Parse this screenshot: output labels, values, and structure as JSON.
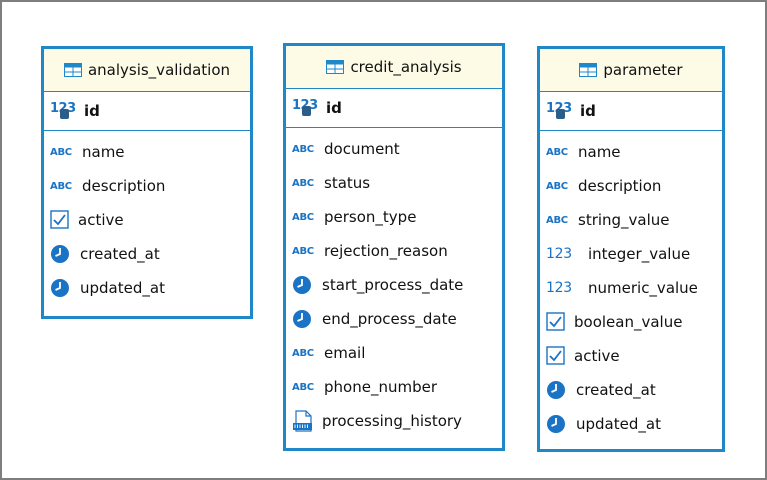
{
  "tables": [
    {
      "name": "analysis_validation",
      "pk": "id",
      "columns": [
        {
          "label": "name",
          "icon": "abc-icon"
        },
        {
          "label": "description",
          "icon": "abc-icon"
        },
        {
          "label": "active",
          "icon": "checkbox-icon"
        },
        {
          "label": "created_at",
          "icon": "clock-icon"
        },
        {
          "label": "updated_at",
          "icon": "clock-icon"
        }
      ]
    },
    {
      "name": "credit_analysis",
      "pk": "id",
      "columns": [
        {
          "label": "document",
          "icon": "abc-icon"
        },
        {
          "label": "status",
          "icon": "abc-icon"
        },
        {
          "label": "person_type",
          "icon": "abc-icon"
        },
        {
          "label": "rejection_reason",
          "icon": "abc-icon"
        },
        {
          "label": "start_process_date",
          "icon": "clock-icon"
        },
        {
          "label": "end_process_date",
          "icon": "clock-icon"
        },
        {
          "label": "email",
          "icon": "abc-icon"
        },
        {
          "label": "phone_number",
          "icon": "abc-icon"
        },
        {
          "label": "processing_history",
          "icon": "json-icon"
        }
      ]
    },
    {
      "name": "parameter",
      "pk": "id",
      "columns": [
        {
          "label": "name",
          "icon": "abc-icon"
        },
        {
          "label": "description",
          "icon": "abc-icon"
        },
        {
          "label": "string_value",
          "icon": "abc-icon"
        },
        {
          "label": "integer_value",
          "icon": "number-icon"
        },
        {
          "label": "numeric_value",
          "icon": "number-icon"
        },
        {
          "label": "boolean_value",
          "icon": "checkbox-icon"
        },
        {
          "label": "active",
          "icon": "checkbox-icon"
        },
        {
          "label": "created_at",
          "icon": "clock-icon"
        },
        {
          "label": "updated_at",
          "icon": "clock-icon"
        }
      ]
    }
  ],
  "icon_text": {
    "abc": "ABC",
    "num": "123"
  },
  "colors": {
    "entity_border": "#1f88c8",
    "header_bg": "#fdfbe6",
    "icon_blue": "#1a73c4"
  }
}
